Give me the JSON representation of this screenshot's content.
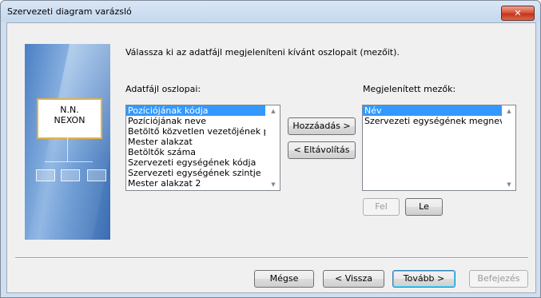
{
  "window": {
    "title": "Szervezeti diagram varázsló",
    "close_label": "✕"
  },
  "art": {
    "card_line1": "N.N.",
    "card_line2": "NEXON"
  },
  "instruction": "Válassza ki az adatfájl megjeleníteni kívánt oszlopait (mezőit).",
  "available": {
    "label": "Adatfájl oszlopai:",
    "items": [
      "Pozíciójának kódja",
      "Pozíciójának neve",
      "Betöltő közvetlen vezetőjének pozíc",
      "Mester alakzat",
      "Betöltők száma",
      "Szervezeti egységének kódja",
      "Szervezeti egységének szintje",
      "Mester alakzat 2"
    ],
    "selected_index": 0
  },
  "displayed": {
    "label": "Megjelenített mezők:",
    "items": [
      "Név",
      "Szervezeti egységének megnevezés"
    ],
    "selected_index": 0
  },
  "buttons": {
    "add": "Hozzáadás >",
    "remove": "< Eltávolítás",
    "up": "Fel",
    "down": "Le",
    "cancel": "Mégse",
    "back": "< Vissza",
    "next": "Tovább >",
    "finish": "Befejezés"
  },
  "icons": {
    "scroll_up": "▲",
    "scroll_down": "▼"
  }
}
